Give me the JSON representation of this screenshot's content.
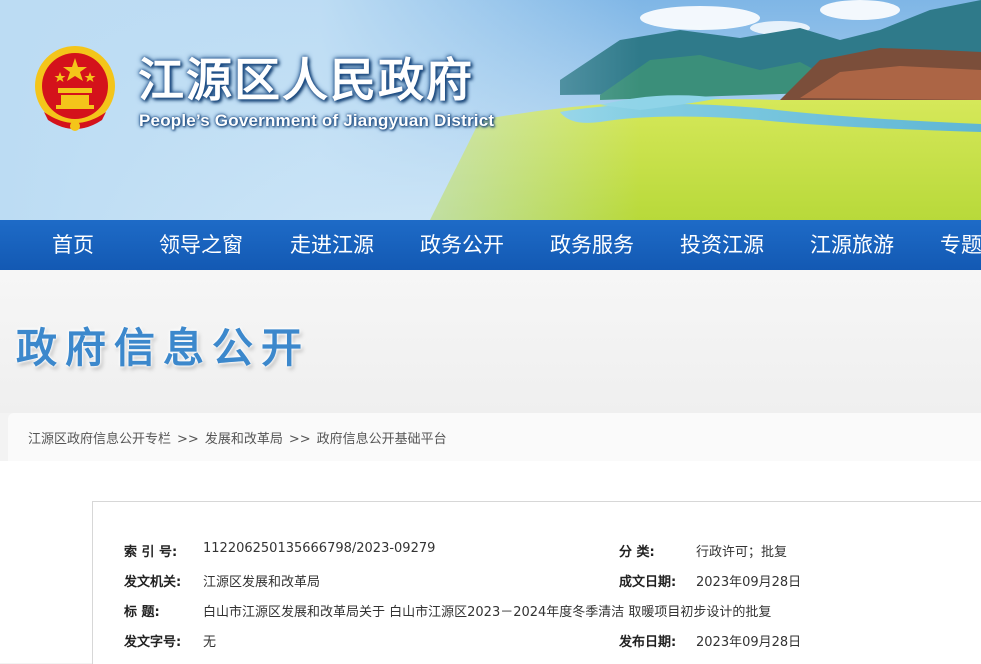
{
  "header": {
    "title": "江源区人民政府",
    "subtitle": "People’s Government of Jiangyuan District"
  },
  "nav": {
    "items": [
      "首页",
      "领导之窗",
      "走进江源",
      "政务公开",
      "政务服务",
      "投资江源",
      "江源旅游",
      "专题"
    ]
  },
  "banner": {
    "title": "政府信息公开"
  },
  "breadcrumb": {
    "items": [
      "江源区政府信息公开专栏",
      "发展和改革局",
      "政府信息公开基础平台"
    ],
    "separator": ">>"
  },
  "info": {
    "index_label": "索 引 号:",
    "index_value": "112206250135666798/2023-09279",
    "category_label": "分    类:",
    "category_value": "行政许可；批复",
    "issuer_label": "发文机关:",
    "issuer_value": "江源区发展和改革局",
    "created_label": "成文日期:",
    "created_value": "2023年09月28日",
    "title_label": "标      题:",
    "title_value": "白山市江源区发展和改革局关于 白山市江源区2023－2024年度冬季清洁 取暖项目初步设计的批复",
    "docno_label": "发文字号:",
    "docno_value": "无",
    "published_label": "发布日期:",
    "published_value": "2023年09月28日"
  },
  "colors": {
    "nav_blue": "#1662be",
    "banner_text": "#3c88cc",
    "emblem_red": "#d4121b",
    "emblem_gold": "#f4c51a"
  },
  "icons": {
    "emblem": "national-emblem-icon"
  }
}
